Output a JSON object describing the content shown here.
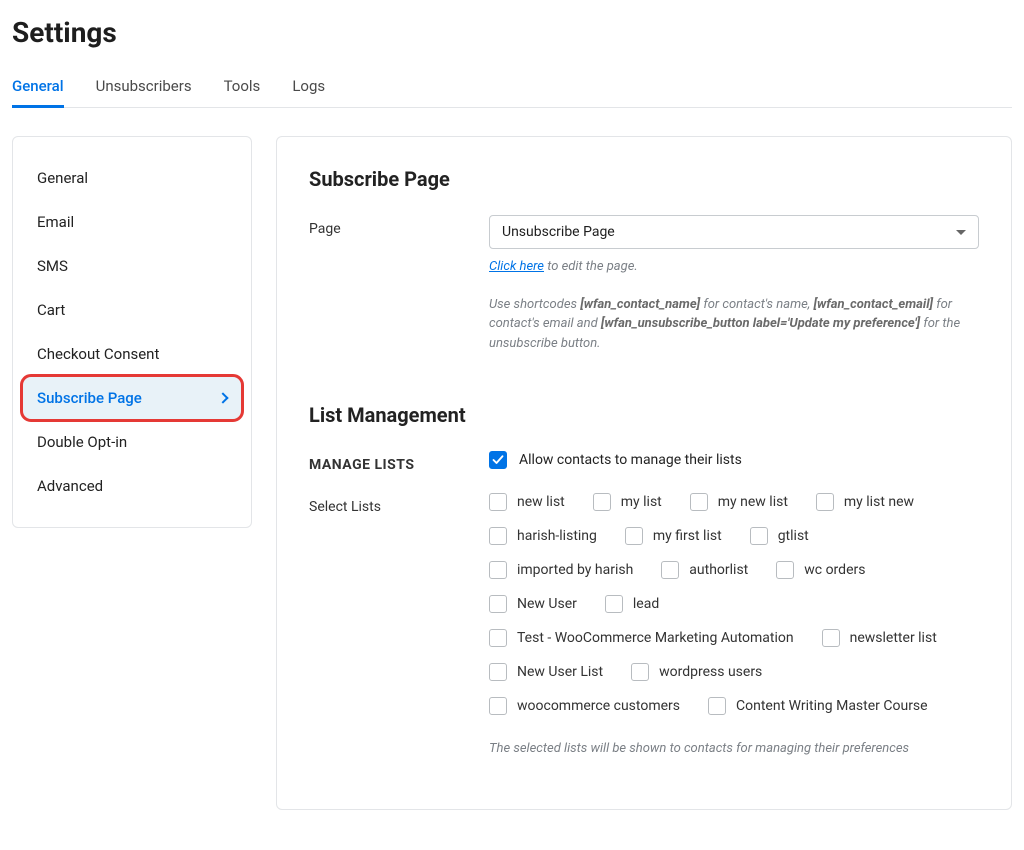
{
  "page_title": "Settings",
  "tabs": [
    {
      "label": "General",
      "active": true
    },
    {
      "label": "Unsubscribers",
      "active": false
    },
    {
      "label": "Tools",
      "active": false
    },
    {
      "label": "Logs",
      "active": false
    }
  ],
  "sidebar": {
    "items": [
      {
        "label": "General",
        "active": false
      },
      {
        "label": "Email",
        "active": false
      },
      {
        "label": "SMS",
        "active": false
      },
      {
        "label": "Cart",
        "active": false
      },
      {
        "label": "Checkout Consent",
        "active": false
      },
      {
        "label": "Subscribe Page",
        "active": true
      },
      {
        "label": "Double Opt-in",
        "active": false
      },
      {
        "label": "Advanced",
        "active": false
      }
    ]
  },
  "subscribe_section": {
    "title": "Subscribe Page",
    "page_label": "Page",
    "page_selected": "Unsubscribe Page",
    "click_here": "Click here",
    "click_here_suffix": " to edit the page.",
    "shortcode_prefix": "Use shortcodes ",
    "sc_name": "[wfan_contact_name]",
    "sc_name_suffix": " for contact's name, ",
    "sc_email": "[wfan_contact_email]",
    "sc_email_suffix": " for contact's email and ",
    "sc_btn": "[wfan_unsubscribe_button label='Update my preference']",
    "sc_btn_suffix": " for the unsubscribe button."
  },
  "list_section": {
    "title": "List Management",
    "manage_label": "MANAGE LISTS",
    "manage_checkbox_label": "Allow contacts to manage their lists",
    "manage_checked": true,
    "select_label": "Select Lists",
    "lists": [
      "new list",
      "my list",
      "my new list",
      "my list new",
      "harish-listing",
      "my first list",
      "gtlist",
      "imported by harish",
      "authorlist",
      "wc orders",
      "New User",
      "lead",
      "Test - WooCommerce Marketing Automation",
      "newsletter list",
      "New User List",
      "wordpress users",
      "woocommerce customers",
      "Content Writing Master Course"
    ],
    "footer_note": "The selected lists will be shown to contacts for managing their preferences"
  }
}
